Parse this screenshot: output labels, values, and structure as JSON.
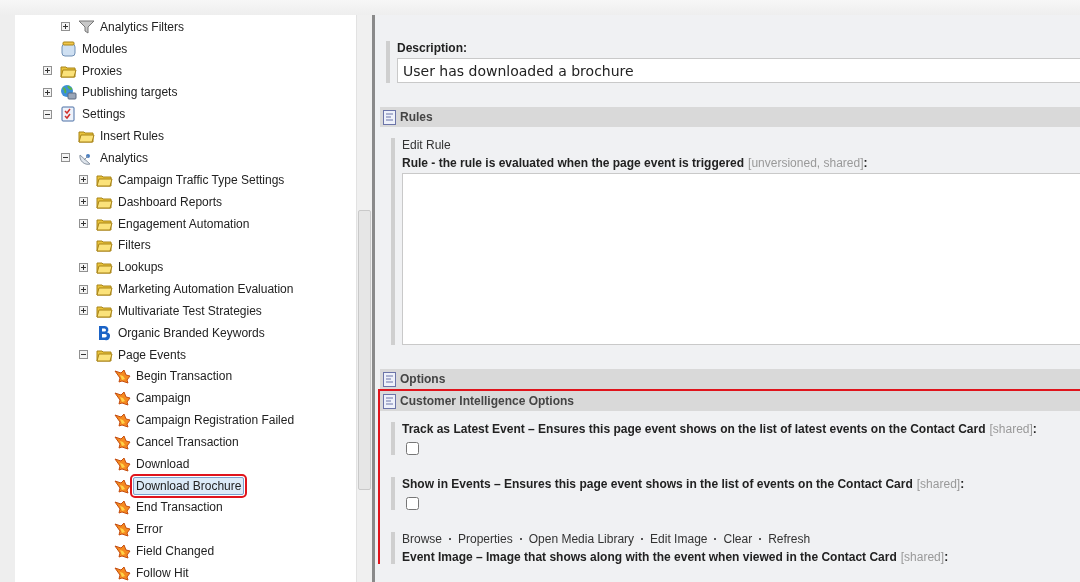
{
  "tree": {
    "continued": [
      {
        "label": "Analytics Filters",
        "kind": "filter",
        "expanded": false,
        "selected": false
      }
    ],
    "items": [
      {
        "label": "Modules",
        "kind": "modules",
        "selected": false
      },
      {
        "label": "Proxies",
        "kind": "folder",
        "expanded": false,
        "selected": false
      },
      {
        "label": "Publishing targets",
        "kind": "globe",
        "expanded": false,
        "selected": false
      },
      {
        "label": "Settings",
        "kind": "settings",
        "expanded": true,
        "selected": false,
        "children": [
          {
            "label": "Insert Rules",
            "kind": "folder",
            "selected": false
          },
          {
            "label": "Analytics",
            "kind": "analytics",
            "expanded": true,
            "selected": false,
            "children": [
              {
                "label": "Campaign Traffic Type Settings",
                "kind": "folder",
                "expanded": false,
                "selected": false
              },
              {
                "label": "Dashboard Reports",
                "kind": "folder",
                "expanded": false,
                "selected": false
              },
              {
                "label": "Engagement Automation",
                "kind": "folder",
                "expanded": false,
                "selected": false
              },
              {
                "label": "Filters",
                "kind": "folder",
                "selected": false
              },
              {
                "label": "Lookups",
                "kind": "folder",
                "expanded": false,
                "selected": false
              },
              {
                "label": "Marketing Automation Evaluation",
                "kind": "folder",
                "expanded": false,
                "selected": false
              },
              {
                "label": "Multivariate Test Strategies",
                "kind": "folder",
                "expanded": false,
                "selected": false
              },
              {
                "label": "Organic Branded Keywords",
                "kind": "b",
                "selected": false
              },
              {
                "label": "Page Events",
                "kind": "folder",
                "expanded": true,
                "selected": false,
                "children": [
                  {
                    "label": "Begin Transaction",
                    "kind": "event",
                    "selected": false
                  },
                  {
                    "label": "Campaign",
                    "kind": "event",
                    "selected": false
                  },
                  {
                    "label": "Campaign Registration Failed",
                    "kind": "event",
                    "selected": false
                  },
                  {
                    "label": "Cancel Transaction",
                    "kind": "event",
                    "selected": false
                  },
                  {
                    "label": "Download",
                    "kind": "event",
                    "selected": false
                  },
                  {
                    "label": "Download Brochure",
                    "kind": "event",
                    "selected": true,
                    "highlighted": true
                  },
                  {
                    "label": "End Transaction",
                    "kind": "event",
                    "selected": false
                  },
                  {
                    "label": "Error",
                    "kind": "event",
                    "selected": false
                  },
                  {
                    "label": "Field Changed",
                    "kind": "event",
                    "selected": false
                  },
                  {
                    "label": "Follow Hit",
                    "kind": "event",
                    "selected": false
                  }
                ]
              }
            ]
          }
        ]
      }
    ]
  },
  "editor": [
    {
      "kind": "fields",
      "fields": [
        {
          "kind": "text",
          "label": "Description:",
          "value": "User has downloaded a brochure"
        }
      ]
    },
    {
      "kind": "section",
      "title": "Rules",
      "highlighted": false,
      "fields": [
        {
          "kind": "rule",
          "action": "Edit Rule",
          "label": "Rule - the rule is evaluated when the page event is triggered",
          "qualifier": "[unversioned, shared]",
          "suffix": ":"
        }
      ]
    },
    {
      "kind": "section",
      "title": "Options",
      "highlighted": false
    },
    {
      "kind": "section",
      "title": "Customer Intelligence Options",
      "highlighted": true,
      "fields": [
        {
          "kind": "checkbox",
          "label": "Track as Latest Event – Ensures this page event shows on the list of latest events on the Contact Card",
          "qualifier": "[shared]",
          "suffix": ":",
          "checked": false
        },
        {
          "kind": "checkbox",
          "label": "Show in Events – Ensures this page event shows in the list of events on the Contact Card",
          "qualifier": "[shared]",
          "suffix": ":",
          "checked": false
        },
        {
          "kind": "image",
          "actions": [
            "Browse",
            "Properties",
            "Open Media Library",
            "Edit Image",
            "Clear",
            "Refresh"
          ],
          "label": "Event Image – Image that shows along with the event when viewed in the Contact Card",
          "qualifier": "[shared]",
          "suffix": ":"
        }
      ]
    }
  ]
}
